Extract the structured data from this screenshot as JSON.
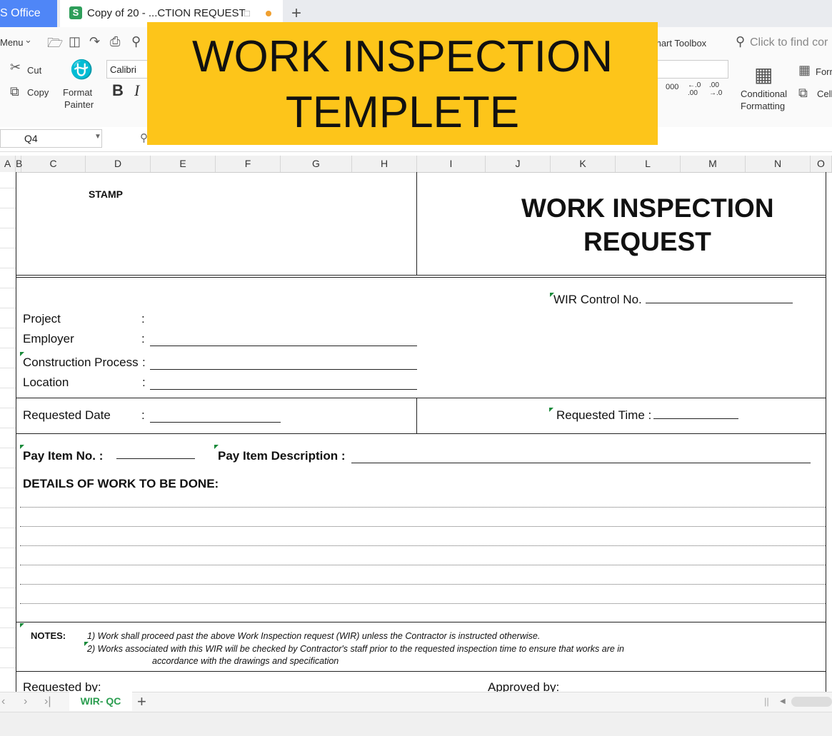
{
  "tabs": {
    "app_label": "S Office",
    "doc_title": "Copy of 20 - ...CTION REQUEST",
    "new_tab": "+"
  },
  "toolbar": {
    "menu_label": "Menu",
    "cut_label": "Cut",
    "copy_label": "Copy",
    "format_painter_line1": "Format",
    "format_painter_line2": "Painter",
    "font_name": "Calibri",
    "smart_toolbox": "mart Toolbox",
    "search_placeholder": "Click to find cor",
    "conditional_line1": "Conditional",
    "conditional_line2": "Formatting",
    "format_label": "Forr",
    "cell_label": "Cell",
    "bold_label": "B",
    "italic_label": "I",
    "thousands": "000",
    "dec_inc": "←.0 .00",
    "dec_dec": ".00 →.0"
  },
  "formula_bar": {
    "name_box": "Q4"
  },
  "columns": [
    "A",
    "B",
    "C",
    "D",
    "E",
    "F",
    "G",
    "H",
    "I",
    "J",
    "K",
    "L",
    "M",
    "N",
    "O"
  ],
  "banner": {
    "line1": "WORK INSPECTION",
    "line2": "TEMPLETE"
  },
  "form": {
    "stamp": "STAMP",
    "title_line1": "WORK INSPECTION",
    "title_line2": "REQUEST",
    "wir_control": "WIR Control No.",
    "project": "Project",
    "employer": "Employer",
    "construction_process": "Construction Process",
    "location": "Location",
    "colon": ":",
    "requested_date": "Requested Date",
    "requested_time": "Requested Time :",
    "pay_item_no": "Pay Item No. :",
    "pay_item_desc": "Pay Item Description :",
    "details": "DETAILS OF WORK TO BE DONE:",
    "notes_label": "NOTES:",
    "note1": "1) Work shall proceed past the above Work Inspection request (WIR) unless the Contractor is instructed otherwise.",
    "note2": "2) Works associated with this WIR will be checked by Contractor's staff prior to the requested inspection time to ensure that works are in",
    "note2_cont": "accordance with the drawings and specification",
    "requested_by": "Requested by:",
    "approved_by": "Approved by:"
  },
  "sheet_tabs": {
    "active": "WIR- QC",
    "add": "+"
  }
}
